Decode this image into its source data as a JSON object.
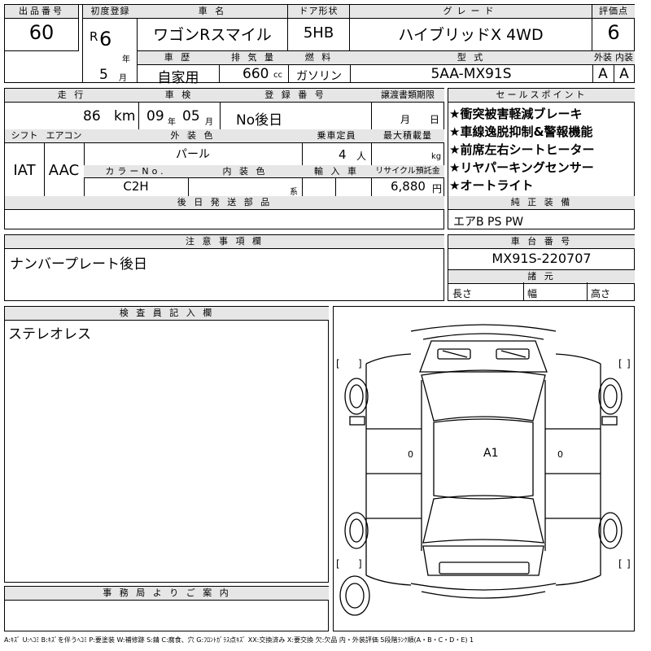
{
  "header": {
    "lot_label": "出品番号",
    "lot_value": "60",
    "first_reg_label": "初度登録",
    "era": "R",
    "reg_year": "6",
    "year_unit": "年",
    "reg_month": "5",
    "month_unit": "月",
    "car_name_label": "車 名",
    "car_name": "ワゴンRスマイル",
    "door_label": "ドア形状",
    "door_value": "5HB",
    "grade_label": "グレード",
    "grade_value": "ハイブリッドX 4WD",
    "score_label": "評価点",
    "score_value": "6",
    "history_label": "車 歴",
    "history_value": "自家用",
    "displacement_label": "排 気 量",
    "displacement_value": "660",
    "displacement_unit": "cc",
    "fuel_label": "燃 料",
    "fuel_value": "ガソリン",
    "model_label": "型 式",
    "model_value": "5AA-MX91S",
    "exterior_label": "外装",
    "exterior_value": "A",
    "interior_label": "内装",
    "interior_value": "A"
  },
  "row2": {
    "mileage_label": "走 行",
    "mileage_value": "86",
    "mileage_unit": "km",
    "inspection_label": "車 検",
    "insp_year": "09",
    "insp_year_unit": "年",
    "insp_month": "05",
    "insp_month_unit": "月",
    "regno_label": "登 録 番 号",
    "regno_value": "No後日",
    "transfer_label": "譲渡書類期限",
    "transfer_month_unit": "月",
    "transfer_day_unit": "日",
    "shift_label": "シフト",
    "shift_value": "IAT",
    "ac_label": "エアコン",
    "ac_value": "AAC",
    "ext_color_label": "外 装 色",
    "ext_color_value": "パール",
    "capacity_label": "乗車定員",
    "capacity_value": "4",
    "capacity_unit": "人",
    "load_label": "最大積載量",
    "load_unit": "kg",
    "color_no_label": "カラーNo.",
    "color_no_value": "C2H",
    "int_color_label": "内 装 色",
    "int_color_unit": "系",
    "import_label": "輸 入 車",
    "recycle_label": "リサイクル預託金",
    "recycle_value": "6,880",
    "recycle_unit": "円",
    "later_parts_label": "後 日 発 送 部 品"
  },
  "sales_points": {
    "title": "セールスポイント",
    "items": [
      "★衝突被害軽減ブレーキ",
      "★車線逸脱抑制&警報機能",
      "★前席左右シートヒーター",
      "★リヤパーキングセンサー",
      "★オートライト"
    ]
  },
  "equipment": {
    "title": "純 正 装 備",
    "value": "エアB PS PW"
  },
  "notes": {
    "title": "注 意 事 項 欄",
    "value": "ナンバープレート後日"
  },
  "chassis": {
    "title": "車 台 番 号",
    "value": "MX91S-220707",
    "dims_title": "諸 元",
    "length_label": "長さ",
    "width_label": "幅",
    "height_label": "高さ"
  },
  "inspector": {
    "title": "検 査 員 記 入 欄",
    "value": "ステレオレス"
  },
  "diagram": {
    "mark": "A1",
    "bracket_open": "[",
    "bracket_close": "]",
    "zero": "0"
  },
  "office": {
    "title": "事 務 局 よ り ご 案 内"
  },
  "legend": "A:ｷｽﾞ U:ﾍｺﾐ B:ｷｽﾞを伴うﾍｺﾐ P:要塗装 W:補修跡 S:錆 C:腐食、穴 G:ﾌﾛﾝﾄｶﾞﾗｽ点ｷｽﾞ XX:交換済み X:要交換 欠:欠品 内・外装評価 5段階ﾗﾝｸ順(A・B・C・D・E) 1"
}
